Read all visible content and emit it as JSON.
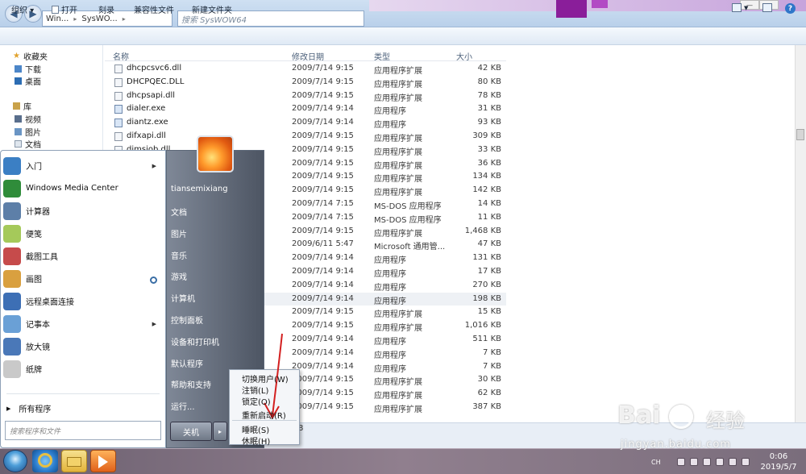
{
  "explorer": {
    "address": [
      "Win...",
      "SysWO..."
    ],
    "search_placeholder": "搜索 SysWOW64",
    "toolbar": {
      "organize": "组织 ▾",
      "open": "打开",
      "burn": "刻录",
      "compat_files": "兼容性文件",
      "new_folder": "新建文件夹"
    },
    "nav": {
      "favorites": "收藏夹",
      "downloads": "下载",
      "desktop": "桌面",
      "libraries": "库",
      "videos": "视频",
      "pictures": "图片",
      "documents": "文档"
    },
    "columns": [
      "名称",
      "修改日期",
      "类型",
      "大小"
    ],
    "files": [
      {
        "name": "dhcpcsvc6.dll",
        "date": "2009/7/14 9:15",
        "type": "应用程序扩展",
        "size": "42 KB",
        "icon": "dll"
      },
      {
        "name": "DHCPQEC.DLL",
        "date": "2009/7/14 9:15",
        "type": "应用程序扩展",
        "size": "80 KB",
        "icon": "dll"
      },
      {
        "name": "dhcpsapi.dll",
        "date": "2009/7/14 9:15",
        "type": "应用程序扩展",
        "size": "78 KB",
        "icon": "dll"
      },
      {
        "name": "dialer.exe",
        "date": "2009/7/14 9:14",
        "type": "应用程序",
        "size": "31 KB",
        "icon": "exe"
      },
      {
        "name": "diantz.exe",
        "date": "2009/7/14 9:14",
        "type": "应用程序",
        "size": "93 KB",
        "icon": "exe"
      },
      {
        "name": "difxapi.dll",
        "date": "2009/7/14 9:15",
        "type": "应用程序扩展",
        "size": "309 KB",
        "icon": "dll"
      },
      {
        "name": "dimsjob.dll",
        "date": "2009/7/14 9:15",
        "type": "应用程序扩展",
        "size": "33 KB",
        "icon": "dll"
      },
      {
        "name": "",
        "date": "2009/7/14 9:15",
        "type": "应用程序扩展",
        "size": "36 KB",
        "icon": "dll"
      },
      {
        "name": "",
        "date": "2009/7/14 9:15",
        "type": "应用程序扩展",
        "size": "134 KB",
        "icon": "dll"
      },
      {
        "name": "",
        "date": "2009/7/14 9:15",
        "type": "应用程序扩展",
        "size": "142 KB",
        "icon": "dll"
      },
      {
        "name": "",
        "date": "2009/7/14 7:15",
        "type": "MS-DOS 应用程序",
        "size": "14 KB",
        "icon": "exe"
      },
      {
        "name": "",
        "date": "2009/7/14 7:15",
        "type": "MS-DOS 应用程序",
        "size": "11 KB",
        "icon": "exe"
      },
      {
        "name": "",
        "date": "2009/7/14 9:15",
        "type": "应用程序扩展",
        "size": "1,468 KB",
        "icon": "dll"
      },
      {
        "name": "",
        "date": "2009/6/11 5:47",
        "type": "Microsoft 通用管...",
        "size": "47 KB",
        "icon": "dll"
      },
      {
        "name": "",
        "date": "2009/7/14 9:14",
        "type": "应用程序",
        "size": "131 KB",
        "icon": "exe"
      },
      {
        "name": "",
        "date": "2009/7/14 9:14",
        "type": "应用程序",
        "size": "17 KB",
        "icon": "exe"
      },
      {
        "name": "",
        "date": "2009/7/14 9:14",
        "type": "应用程序",
        "size": "270 KB",
        "icon": "exe"
      },
      {
        "name": "",
        "date": "2009/7/14 9:14",
        "type": "应用程序",
        "size": "198 KB",
        "icon": "exe",
        "selected": true
      },
      {
        "name": "",
        "date": "2009/7/14 9:15",
        "type": "应用程序扩展",
        "size": "15 KB",
        "icon": "dll"
      },
      {
        "name": "",
        "date": "2009/7/14 9:15",
        "type": "应用程序扩展",
        "size": "1,016 KB",
        "icon": "dll"
      },
      {
        "name": "",
        "date": "2009/7/14 9:14",
        "type": "应用程序",
        "size": "511 KB",
        "icon": "exe"
      },
      {
        "name": "",
        "date": "2009/7/14 9:14",
        "type": "应用程序",
        "size": "7 KB",
        "icon": "exe"
      },
      {
        "name": "",
        "date": "2009/7/14 9:14",
        "type": "应用程序",
        "size": "7 KB",
        "icon": "exe"
      },
      {
        "name": "",
        "date": "2009/7/14 9:15",
        "type": "应用程序扩展",
        "size": "30 KB",
        "icon": "dll"
      },
      {
        "name": "",
        "date": "2009/7/14 9:15",
        "type": "应用程序扩展",
        "size": "62 KB",
        "icon": "dll"
      },
      {
        "name": "",
        "date": "2009/7/14 9:15",
        "type": "应用程序扩展",
        "size": "387 KB",
        "icon": "dll"
      }
    ],
    "status_text": "8"
  },
  "start_menu": {
    "left_items": [
      {
        "label": "入门",
        "arrow": "▶",
        "color": "#3b7fc4"
      },
      {
        "label": "Windows Media Center",
        "arrow": "",
        "color": "#2f8c3a"
      },
      {
        "label": "计算器",
        "arrow": "",
        "color": "#5d7fa8"
      },
      {
        "label": "便笺",
        "arrow": "",
        "color": "#a5c95a"
      },
      {
        "label": "截图工具",
        "arrow": "",
        "color": "#c64b4b"
      },
      {
        "label": "画图",
        "arrow": "",
        "color": "#d9a03f"
      },
      {
        "label": "远程桌面连接",
        "arrow": "",
        "color": "#3d6fb5"
      },
      {
        "label": "记事本",
        "arrow": "▶",
        "color": "#6aa0d6"
      },
      {
        "label": "放大镜",
        "arrow": "",
        "color": "#4a78b8"
      },
      {
        "label": "纸牌",
        "arrow": "",
        "color": "#c9c9c9"
      }
    ],
    "all_programs": "所有程序",
    "all_programs_arrow": "▶",
    "search_placeholder": "搜索程序和文件",
    "user_name": "tiansemixiang",
    "right_items": [
      "文档",
      "图片",
      "音乐",
      "游戏",
      "计算机",
      "控制面板",
      "设备和打印机",
      "默认程序",
      "帮助和支持",
      "运行..."
    ],
    "shutdown": "关机",
    "shutdown_arrow": "▸"
  },
  "power_menu": {
    "items": [
      "切换用户(W)",
      "注销(L)",
      "锁定(O)",
      "重新启动(R)",
      "睡眠(S)",
      "休眠(H)"
    ]
  },
  "taskbar": {
    "tray_lang": "CH",
    "time": "0:06",
    "date": "2019/5/7"
  },
  "watermark": {
    "brand": "Bai",
    "brand_tail": "经验",
    "site": "jingyan.baidu.com"
  }
}
